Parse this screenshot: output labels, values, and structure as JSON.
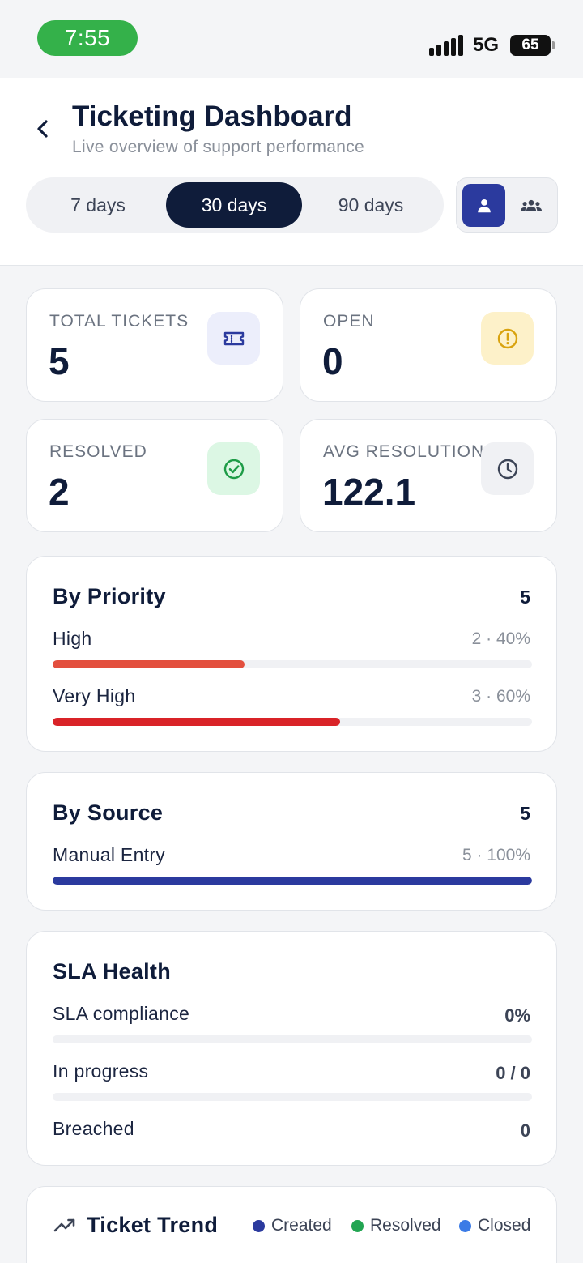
{
  "status": {
    "time": "7:55",
    "network": "5G",
    "battery": "65"
  },
  "header": {
    "title": "Ticketing Dashboard",
    "subtitle": "Live overview of support performance",
    "ranges": [
      "7 days",
      "30 days",
      "90 days"
    ],
    "active_range": "30 days",
    "view_toggle": {
      "active": "person-icon",
      "other": "group-icon"
    }
  },
  "stats": [
    {
      "label": "TOTAL TICKETS",
      "value": "5",
      "icon": "ticket-icon",
      "icon_bg": "#eceefb",
      "icon_color": "#2b3a9e"
    },
    {
      "label": "OPEN",
      "value": "0",
      "icon": "alert-circle-icon",
      "icon_bg": "#fdf1c9",
      "icon_color": "#d9a30f"
    },
    {
      "label": "RESOLVED",
      "value": "2",
      "icon": "check-circle-icon",
      "icon_bg": "#dcf7e4",
      "icon_color": "#1e9c47"
    },
    {
      "label": "AVG RESOLUTION",
      "value": "122.1",
      "icon": "clock-icon",
      "icon_bg": "#f0f1f4",
      "icon_color": "#3c4456"
    }
  ],
  "priority": {
    "title": "By Priority",
    "total": "5",
    "rows": [
      {
        "label": "High",
        "meta": "2 · 40%",
        "percent": 40,
        "color": "#e34f3e"
      },
      {
        "label": "Very High",
        "meta": "3 · 60%",
        "percent": 60,
        "color": "#d92328"
      }
    ]
  },
  "source": {
    "title": "By Source",
    "total": "5",
    "rows": [
      {
        "label": "Manual Entry",
        "meta": "5 · 100%",
        "percent": 100,
        "color": "#2b3a9e"
      }
    ]
  },
  "sla": {
    "title": "SLA Health",
    "rows": [
      {
        "label": "SLA compliance",
        "value": "0%",
        "percent": 0
      },
      {
        "label": "In progress",
        "value": "0 / 0",
        "percent": 0
      },
      {
        "label": "Breached",
        "value": "0"
      }
    ]
  },
  "trend": {
    "title": "Ticket Trend",
    "legend": [
      {
        "name": "Created",
        "color": "#2b3a9e"
      },
      {
        "name": "Resolved",
        "color": "#22a552"
      },
      {
        "name": "Closed",
        "color": "#3b7be6"
      }
    ]
  }
}
